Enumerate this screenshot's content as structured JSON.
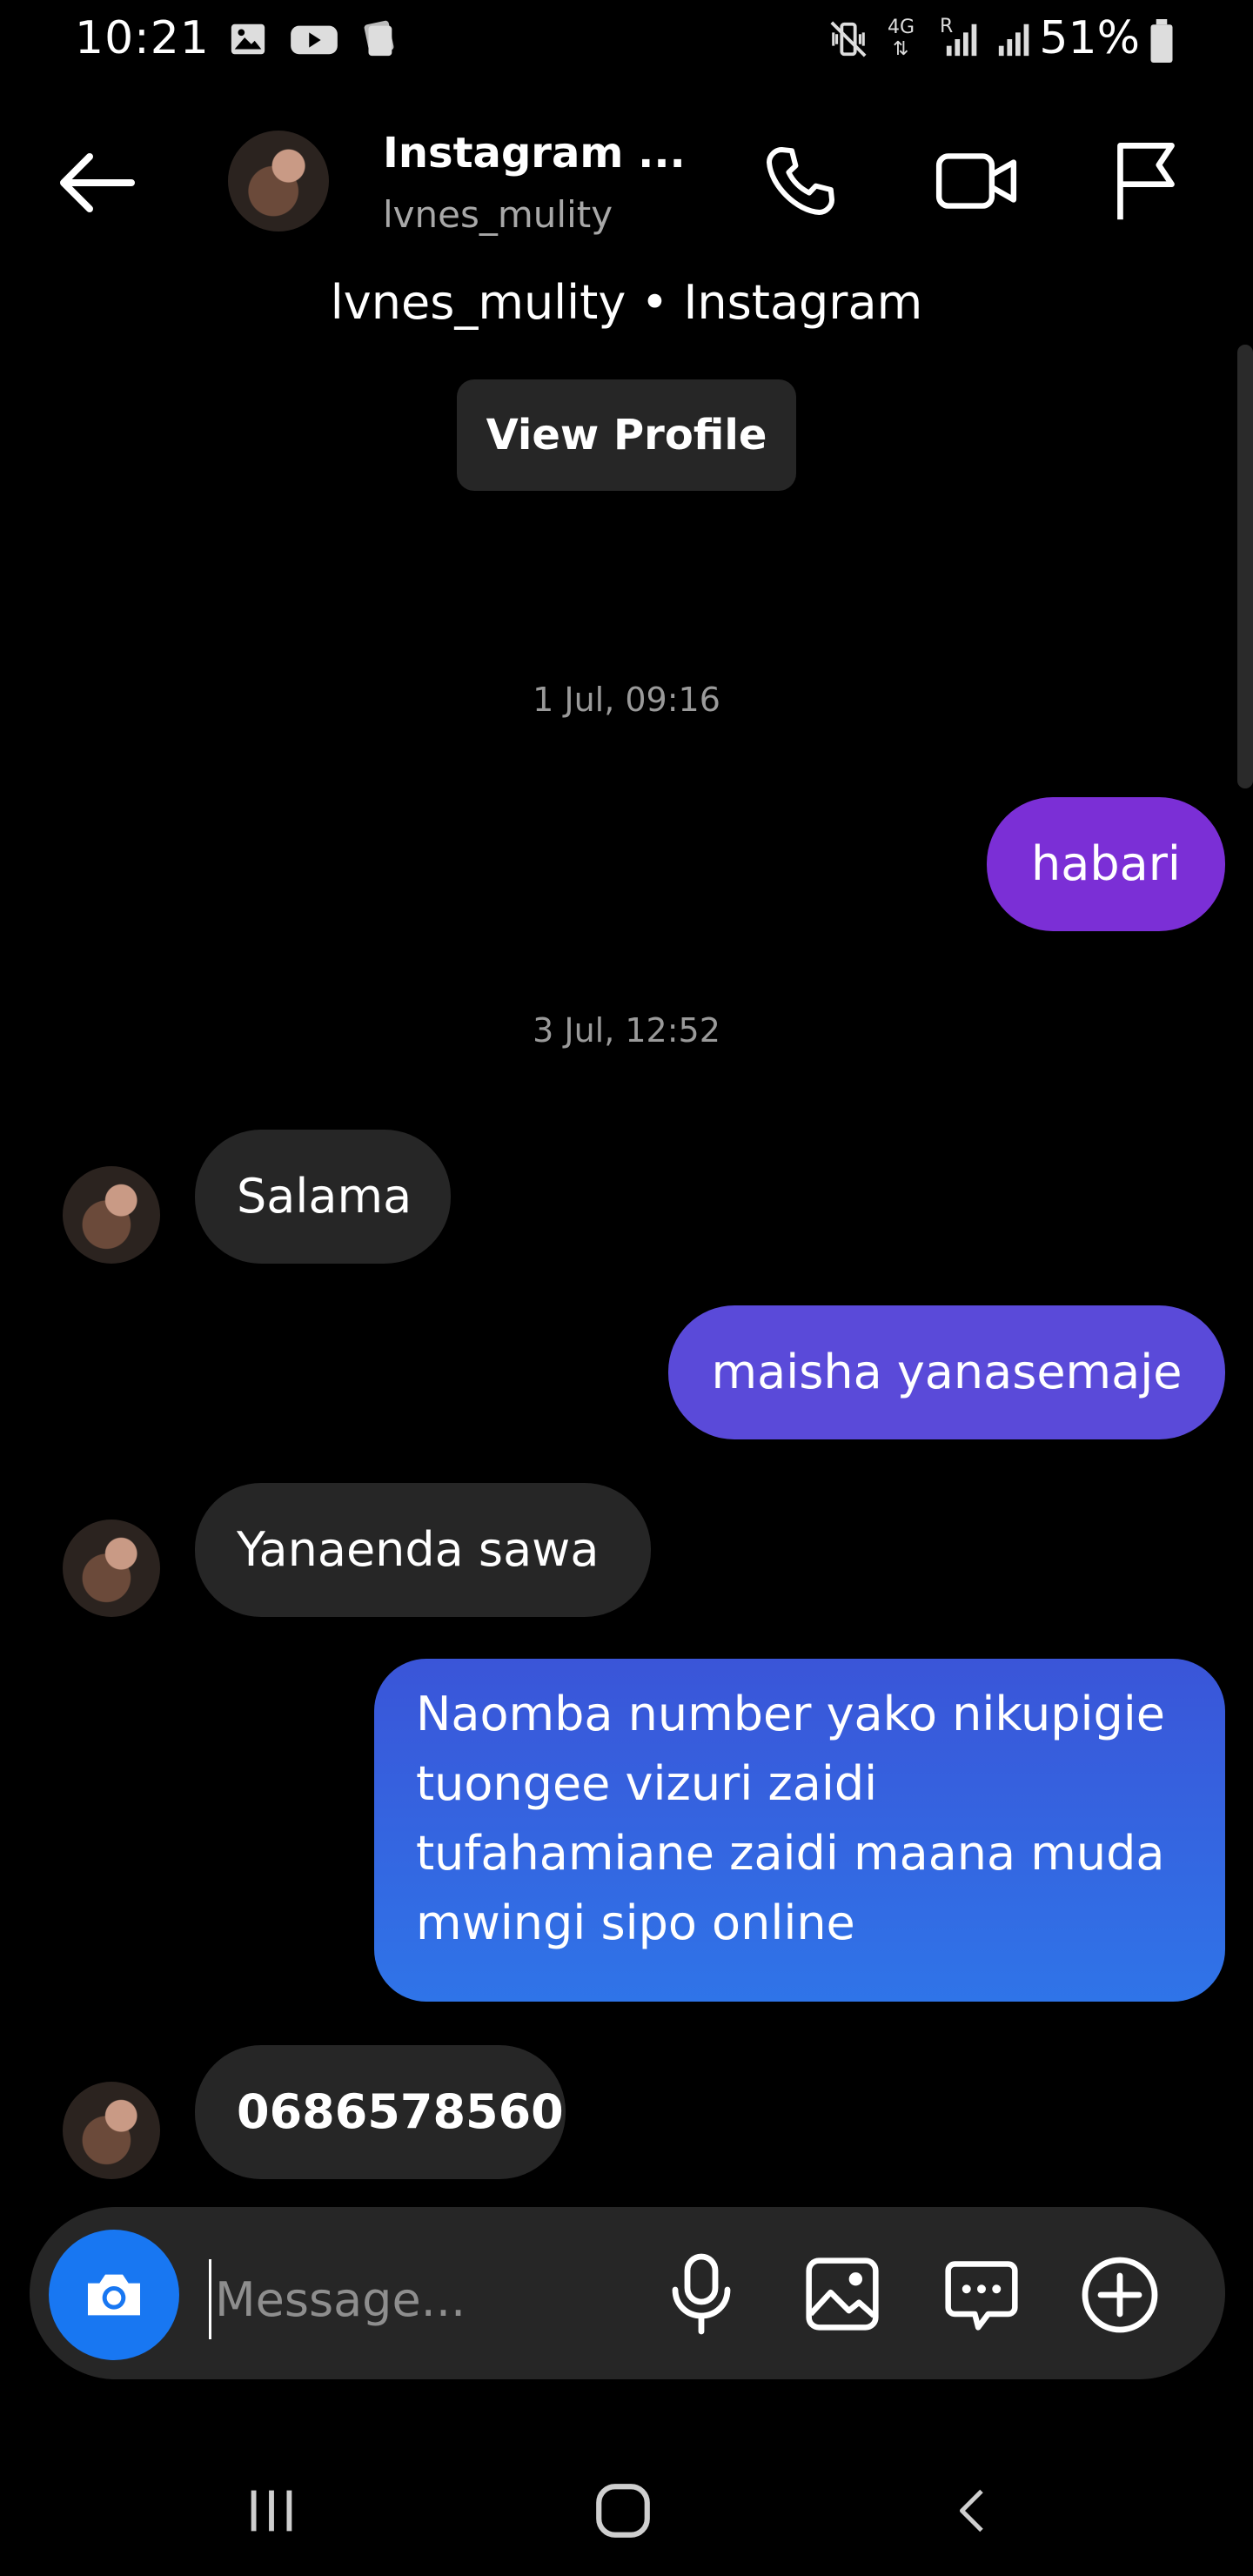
{
  "status_bar": {
    "time": "10:21",
    "network": "4G",
    "roaming": "R",
    "battery": "51%"
  },
  "header": {
    "title": "Instagram ...",
    "subtitle": "lvnes_mulity",
    "thread_source": "lvnes_mulity • Instagram",
    "view_profile_label": "View Profile"
  },
  "messages": [
    {
      "type": "timestamp",
      "text": "1 Jul, 09:16"
    },
    {
      "type": "outgoing",
      "text": "habari",
      "color": "#7b2fd6"
    },
    {
      "type": "timestamp",
      "text": "3 Jul, 12:52"
    },
    {
      "type": "incoming",
      "text": "Salama"
    },
    {
      "type": "outgoing",
      "text": "maisha yanasemaje",
      "color": "#5a4ad9"
    },
    {
      "type": "incoming",
      "text": "Yanaenda sawa"
    },
    {
      "type": "outgoing",
      "text": "Naomba number yako nikupigie tuongee vizuri zaidi tufahamiane zaidi maana muda mwingi sipo online",
      "color": "#3a63e0"
    },
    {
      "type": "incoming",
      "text": "0686578560"
    }
  ],
  "composer": {
    "placeholder": "Message...",
    "camera_color": "#1877f2"
  },
  "icons": {
    "back": "arrow-left-icon",
    "call": "phone-icon",
    "video": "video-camera-icon",
    "report": "flag-icon",
    "camera": "camera-icon",
    "mic": "microphone-icon",
    "gallery": "image-icon",
    "sticker": "chat-bubble-icon",
    "more": "plus-circle-icon"
  }
}
